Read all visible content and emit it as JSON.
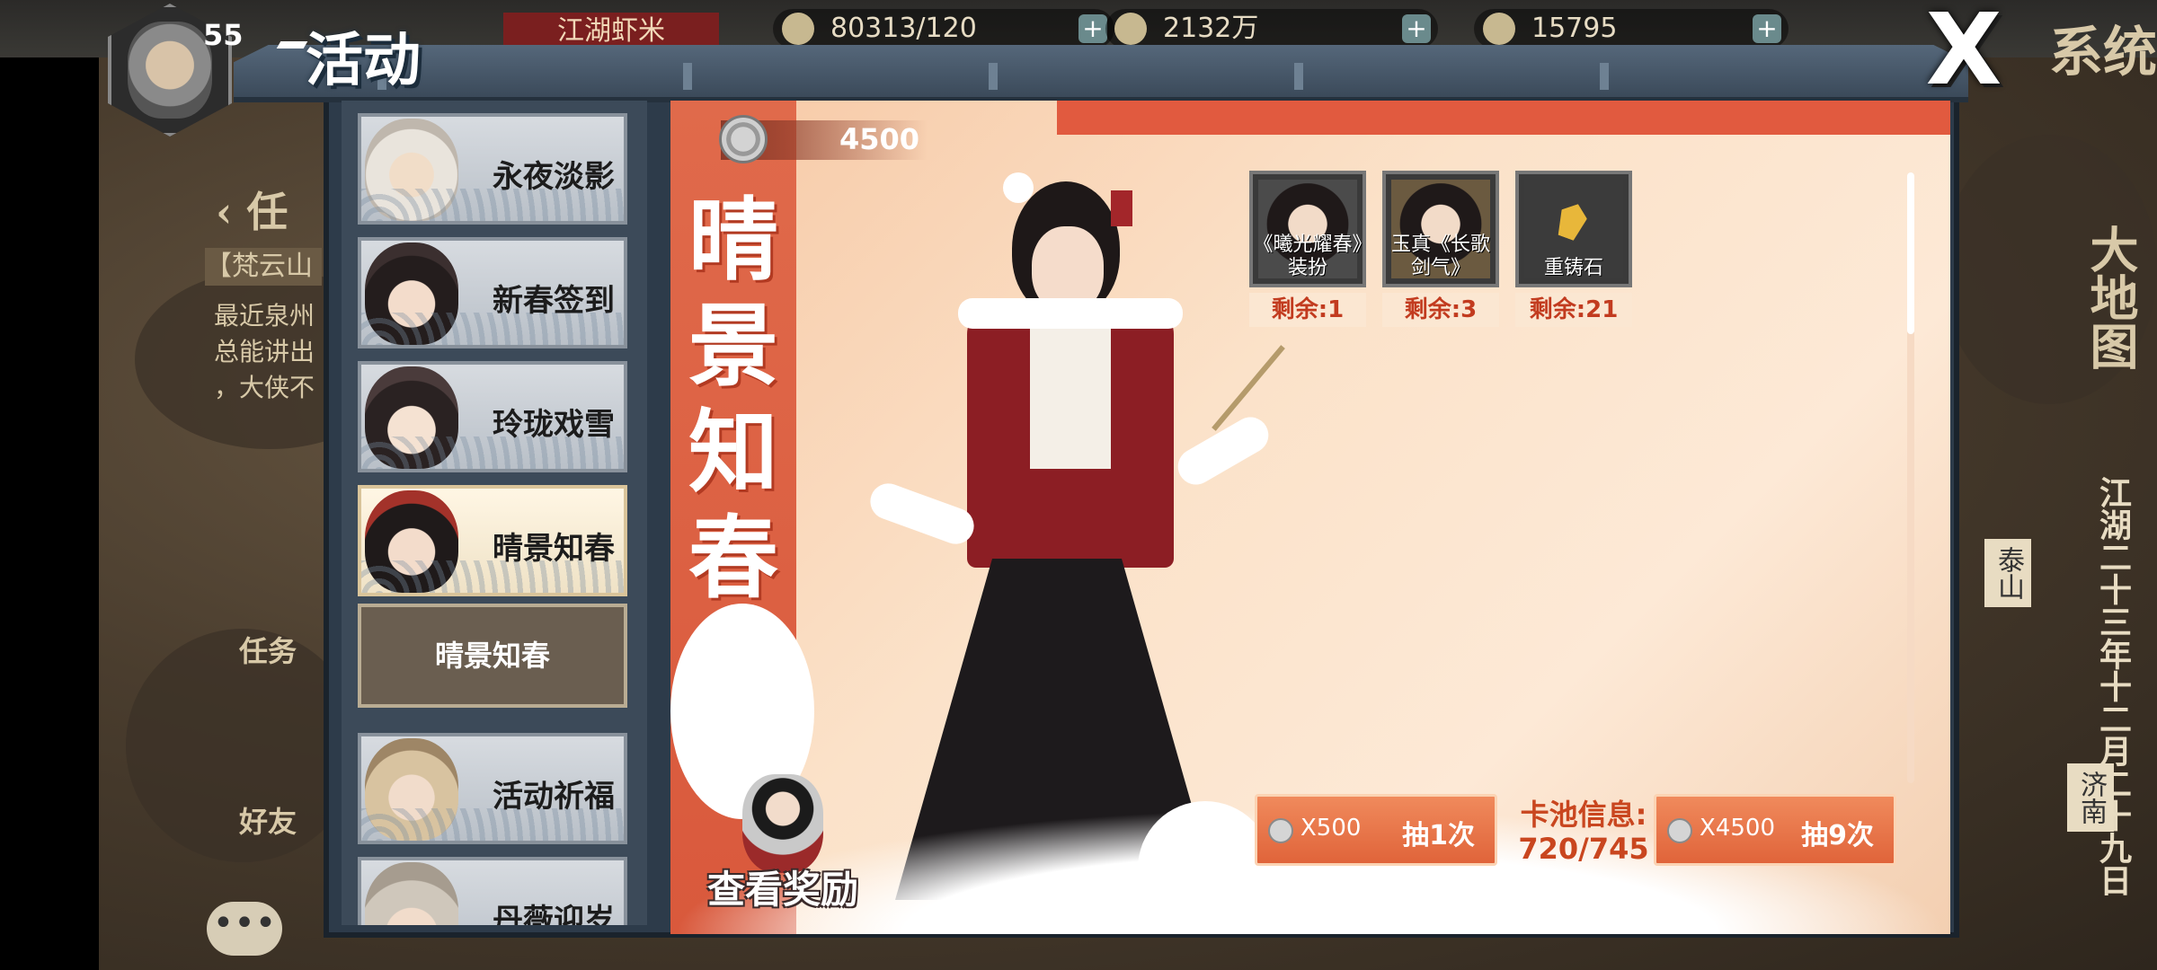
{
  "hud": {
    "level": "55",
    "resources": [
      {
        "icon": "energy-icon",
        "value": "80313/120"
      },
      {
        "icon": "silver-coin-icon",
        "value": "2132万"
      },
      {
        "icon": "ingot-icon",
        "value": "15795"
      }
    ],
    "top_tag": "江湖虾米",
    "system_label": "系统"
  },
  "background": {
    "task_header": "任",
    "quest_title": "【梵云山",
    "quest_lines": [
      "最近泉州",
      "总能讲出",
      "，大侠不"
    ],
    "task_button": "任务",
    "friend_button": "好友",
    "world_map": "大地图",
    "date": "江湖二十三年十二月二十九日",
    "place_taishan": "泰山",
    "place_jinan": "济南"
  },
  "popup": {
    "title": "活动",
    "close_label": "X"
  },
  "sidebar": {
    "items": [
      {
        "label": "永夜淡影",
        "selected": false
      },
      {
        "label": "新春签到",
        "selected": false
      },
      {
        "label": "玲珑戏雪",
        "selected": false
      },
      {
        "label": "晴景知春",
        "selected": true
      },
      {
        "label": "活动祈福",
        "selected": false
      },
      {
        "label": "丹薇迎岁",
        "selected": false
      }
    ],
    "sub_tab": "晴景知春"
  },
  "banner": {
    "currency": "4500",
    "title": "晴景知春",
    "help": "?",
    "rewards": [
      {
        "name": "《曦光耀春》装扮",
        "remaining": "剩余:1"
      },
      {
        "name": "玉真《长歌剑气》",
        "remaining": "剩余:3"
      },
      {
        "name": "重铸石",
        "remaining": "剩余:21"
      }
    ],
    "draw_single": {
      "cost": "X500",
      "label": "抽1次"
    },
    "draw_multi": {
      "cost": "X4500",
      "label": "抽9次"
    },
    "pool_info_label": "卡池信息:",
    "pool_info_value": "720/745",
    "view_rewards": "查看奖励"
  }
}
